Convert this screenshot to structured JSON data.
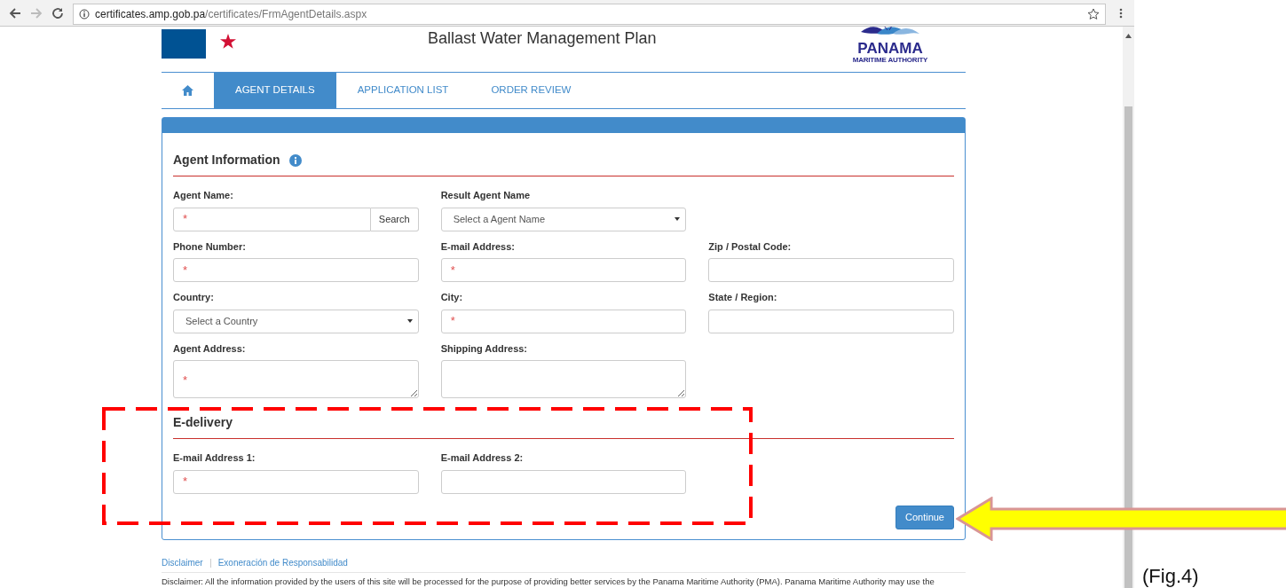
{
  "browser": {
    "url_host": "certificates.amp.gob.pa",
    "url_path": "/certificates/FrmAgentDetails.aspx"
  },
  "header": {
    "title": "Ballast Water Management Plan",
    "logo_name": "PANAMA",
    "logo_subtitle": "MARITIME AUTHORITY"
  },
  "tabs": [
    {
      "kind": "home",
      "selected": false
    },
    {
      "kind": "text",
      "label": "AGENT DETAILS",
      "selected": true
    },
    {
      "kind": "text",
      "label": "APPLICATION LIST",
      "selected": false
    },
    {
      "kind": "text",
      "label": "ORDER REVIEW",
      "selected": false
    }
  ],
  "sections": [
    {
      "title": "Agent Information",
      "info": true,
      "rows": [
        [
          {
            "label": "Agent Name:",
            "kind": "search",
            "placeholder": "*",
            "button": "Search"
          },
          {
            "label": "Result Agent Name",
            "kind": "select",
            "value": "Select a Agent Name"
          }
        ],
        [
          {
            "label": "Phone Number:",
            "kind": "input",
            "placeholder": "*"
          },
          {
            "label": "E-mail Address:",
            "kind": "input",
            "placeholder": "*"
          },
          {
            "label": "Zip / Postal Code:",
            "kind": "input"
          }
        ],
        [
          {
            "label": "Country:",
            "kind": "select",
            "value": "Select a Country"
          },
          {
            "label": "City:",
            "kind": "input",
            "placeholder": "*"
          },
          {
            "label": "State / Region:",
            "kind": "input"
          }
        ],
        [
          {
            "label": "Agent Address:",
            "kind": "textarea",
            "placeholder": "*"
          },
          {
            "label": "Shipping Address:",
            "kind": "textarea"
          }
        ]
      ]
    },
    {
      "title": "E-delivery",
      "info": false,
      "rows": [
        [
          {
            "label": "E-mail Address 1:",
            "kind": "input",
            "placeholder": "*"
          },
          {
            "label": "E-mail Address 2:",
            "kind": "input"
          }
        ]
      ]
    }
  ],
  "continue_button": "Continue",
  "footer": {
    "links": [
      "Disclaimer",
      "Exoneración de Responsabilidad"
    ],
    "text": "Disclaimer: All the information provided by the users of this site will be processed for the purpose of providing better services by the Panama Maritime Authority (PMA). Panama Maritime Authority may use the"
  },
  "caption": "(Fig.4)"
}
